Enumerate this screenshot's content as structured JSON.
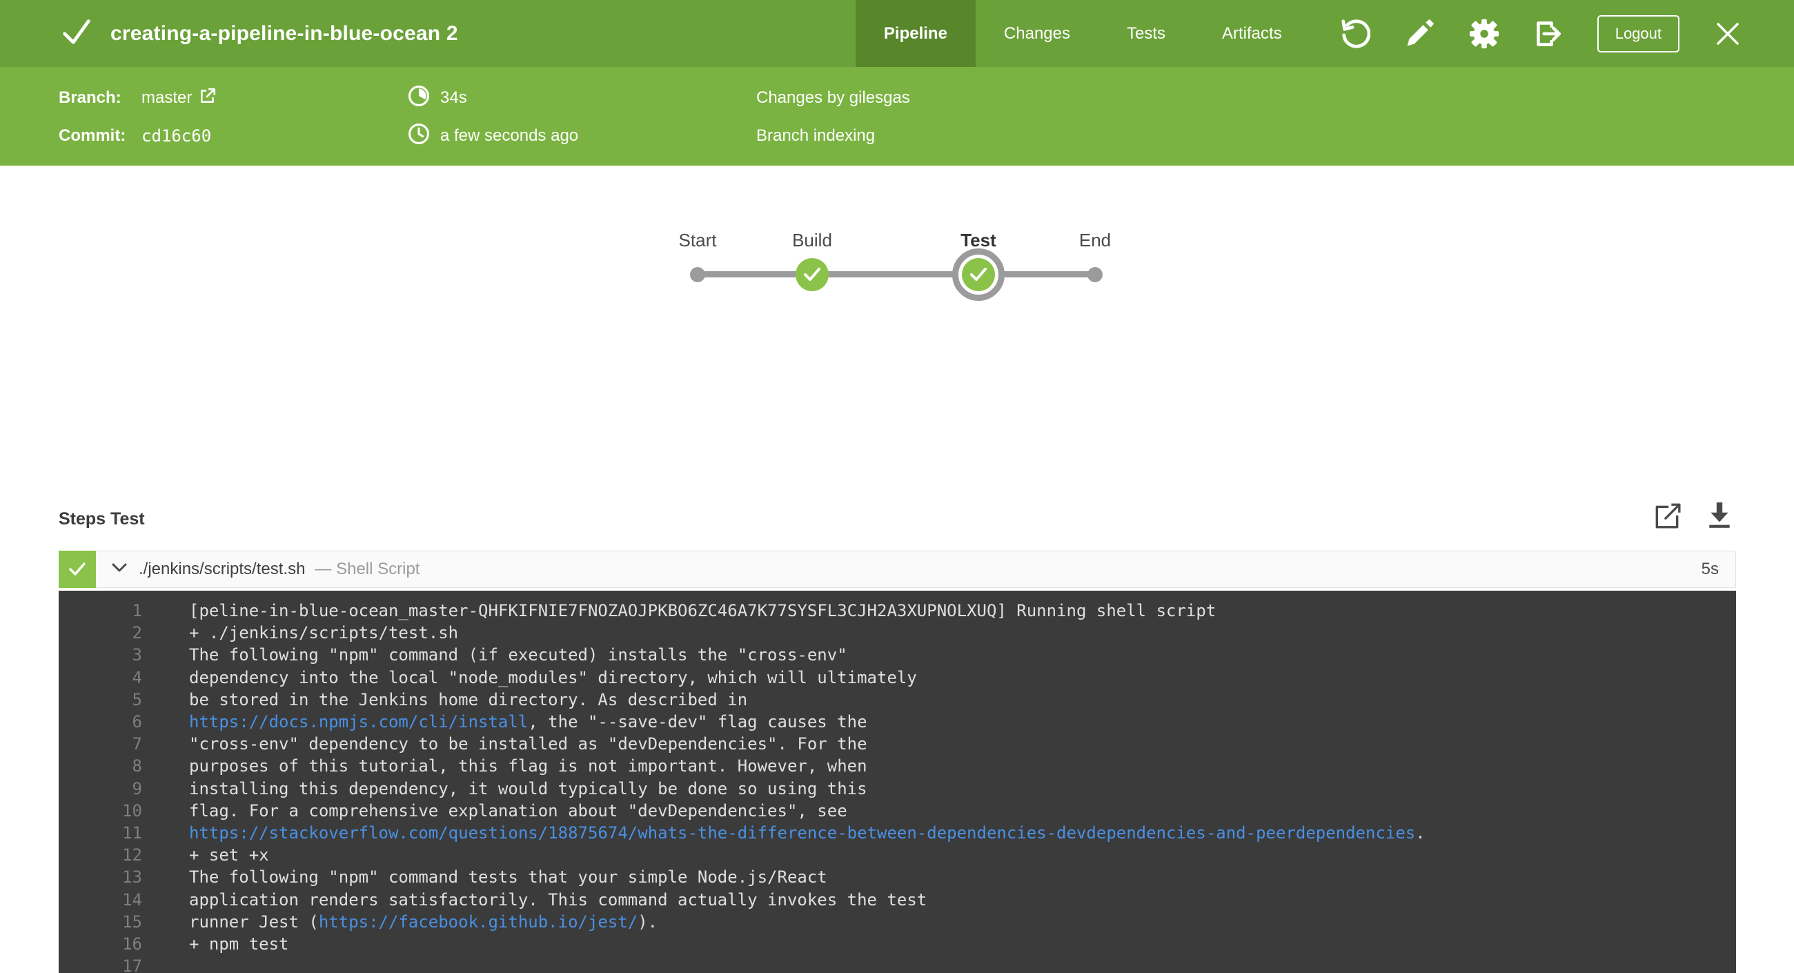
{
  "header": {
    "title": "creating-a-pipeline-in-blue-ocean 2",
    "status": "success",
    "tabs": [
      {
        "label": "Pipeline",
        "active": true
      },
      {
        "label": "Changes",
        "active": false
      },
      {
        "label": "Tests",
        "active": false
      },
      {
        "label": "Artifacts",
        "active": false
      }
    ],
    "logout_label": "Logout"
  },
  "info_bar": {
    "branch_label": "Branch:",
    "branch_value": "master",
    "commit_label": "Commit:",
    "commit_value": "cd16c60",
    "duration": "34s",
    "time_ago": "a few seconds ago",
    "changes_by": "Changes by gilesgas",
    "cause": "Branch indexing"
  },
  "pipeline": {
    "stages": [
      {
        "label": "Start",
        "type": "dot",
        "selected": false
      },
      {
        "label": "Build",
        "type": "success",
        "selected": false
      },
      {
        "label": "Test",
        "type": "success",
        "selected": true
      },
      {
        "label": "End",
        "type": "dot",
        "selected": false
      }
    ]
  },
  "steps": {
    "heading": "Steps Test",
    "step": {
      "name": "./jenkins/scripts/test.sh",
      "kind": "— Shell Script",
      "duration": "5s",
      "status": "success",
      "expanded": true
    },
    "log": {
      "lines": [
        {
          "num": 1,
          "segments": [
            {
              "t": "[peline-in-blue-ocean_master-QHFKIFNIE7FNOZAOJPKBO6ZC46A7K77SYSFL3CJH2A3XUPNOLXUQ] Running shell script"
            }
          ]
        },
        {
          "num": 2,
          "segments": [
            {
              "t": "+ ./jenkins/scripts/test.sh"
            }
          ]
        },
        {
          "num": 3,
          "segments": [
            {
              "t": "The following \"npm\" command (if executed) installs the \"cross-env\""
            }
          ]
        },
        {
          "num": 4,
          "segments": [
            {
              "t": "dependency into the local \"node_modules\" directory, which will ultimately"
            }
          ]
        },
        {
          "num": 5,
          "segments": [
            {
              "t": "be stored in the Jenkins home directory. As described in"
            }
          ]
        },
        {
          "num": 6,
          "segments": [
            {
              "t": "https://docs.npmjs.com/cli/install",
              "link": true
            },
            {
              "t": ", the \"--save-dev\" flag causes the"
            }
          ]
        },
        {
          "num": 7,
          "segments": [
            {
              "t": "\"cross-env\" dependency to be installed as \"devDependencies\". For the"
            }
          ]
        },
        {
          "num": 8,
          "segments": [
            {
              "t": "purposes of this tutorial, this flag is not important. However, when"
            }
          ]
        },
        {
          "num": 9,
          "segments": [
            {
              "t": "installing this dependency, it would typically be done so using this"
            }
          ]
        },
        {
          "num": 10,
          "segments": [
            {
              "t": "flag. For a comprehensive explanation about \"devDependencies\", see"
            }
          ]
        },
        {
          "num": 11,
          "segments": [
            {
              "t": "https://stackoverflow.com/questions/18875674/whats-the-difference-between-dependencies-devdependencies-and-peerdependencies",
              "link": true
            },
            {
              "t": "."
            }
          ]
        },
        {
          "num": 12,
          "segments": [
            {
              "t": "+ set +x"
            }
          ]
        },
        {
          "num": 13,
          "segments": [
            {
              "t": "The following \"npm\" command tests that your simple Node.js/React"
            }
          ]
        },
        {
          "num": 14,
          "segments": [
            {
              "t": "application renders satisfactorily. This command actually invokes the test"
            }
          ]
        },
        {
          "num": 15,
          "segments": [
            {
              "t": "runner Jest ("
            },
            {
              "t": "https://facebook.github.io/jest/",
              "link": true
            },
            {
              "t": ")."
            }
          ]
        },
        {
          "num": 16,
          "segments": [
            {
              "t": "+ npm test"
            }
          ]
        },
        {
          "num": 17,
          "segments": []
        }
      ]
    }
  },
  "icons": {
    "header_status": "check-icon",
    "branch_link": "external-link-icon",
    "duration": "stopwatch-icon",
    "time": "clock-icon",
    "replay": "replay-arrow-icon",
    "edit": "pencil-icon",
    "settings": "gear-icon",
    "exit": "exit-door-icon",
    "close": "close-x-icon",
    "open_log": "external-link-icon",
    "download_log": "download-icon",
    "step_expand": "chevron-down-icon",
    "step_status": "check-icon"
  },
  "colors": {
    "header_green": "#6AA138",
    "active_tab_green": "#58862B",
    "band_green": "#7BB342",
    "node_green": "#8BC34A",
    "graph_gray": "#9B9B9B",
    "log_background": "#3B3B3C",
    "log_text": "#DFDFDF",
    "log_link_blue": "#4A90E2"
  }
}
